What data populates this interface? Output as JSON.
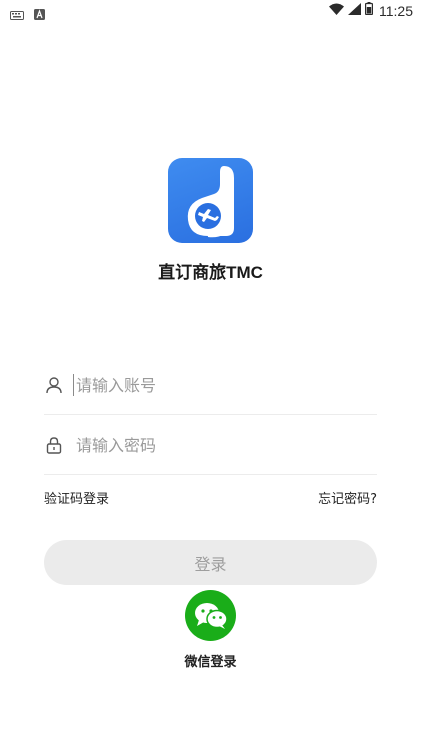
{
  "status_bar": {
    "time": "11:25",
    "left_icons": [
      "keyboard-icon",
      "a-notification-icon"
    ],
    "right_icons": [
      "wifi-icon",
      "signal-icon",
      "battery-icon"
    ]
  },
  "app": {
    "name": "直订商旅TMC",
    "logo_colors": {
      "background": "#3a84ee",
      "shape": "#ffffff",
      "plane": "#2a6fe0"
    }
  },
  "login_form": {
    "account": {
      "placeholder": "请输入账号",
      "value": "",
      "icon": "user-icon"
    },
    "password": {
      "placeholder": "请输入密码",
      "value": "",
      "icon": "lock-icon"
    },
    "sms_login_label": "验证码登录",
    "forgot_password_label": "忘记密码?",
    "submit_label": "登录"
  },
  "third_party": {
    "wechat_label": "微信登录",
    "wechat_icon": "wechat-icon",
    "wechat_color": "#1aad19"
  }
}
